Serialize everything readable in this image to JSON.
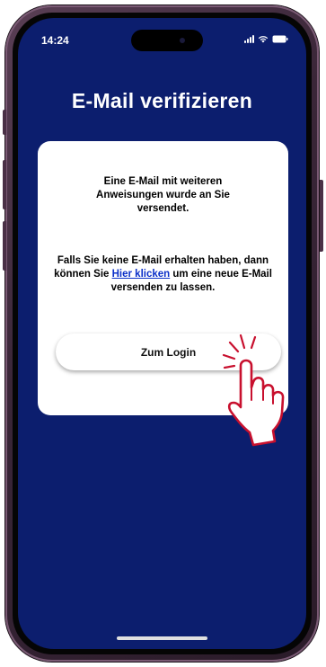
{
  "status_bar": {
    "time": "14:24"
  },
  "page": {
    "title": "E-Mail verifizieren"
  },
  "card": {
    "message_sent": "Eine E-Mail mit weiteren Anweisungen wurde an Sie versendet.",
    "resend_prefix": "Falls Sie keine E-Mail erhalten haben, dann können Sie ",
    "resend_link": "Hier klicken",
    "resend_suffix": " um eine neue E-Mail versenden zu lassen.",
    "login_button": "Zum Login"
  },
  "colors": {
    "screen_background": "#0c1e6e",
    "card_background": "#ffffff",
    "link": "#0a2fc8",
    "hand_outline": "#c8102e"
  },
  "icons": [
    "signal-icon",
    "wifi-icon",
    "battery-icon",
    "pointing-hand-icon"
  ]
}
